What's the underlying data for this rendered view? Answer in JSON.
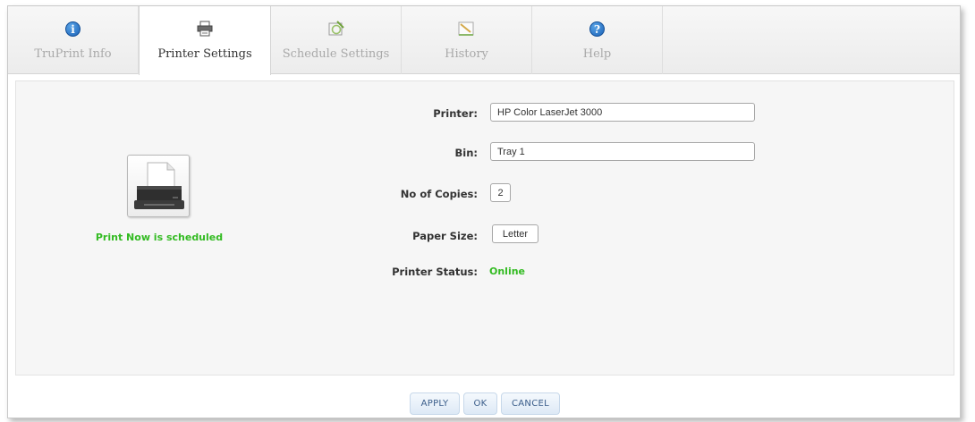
{
  "tabs": [
    {
      "label": "TruPrint Info",
      "icon": "info-icon"
    },
    {
      "label": "Printer Settings",
      "icon": "printer-icon",
      "active": true
    },
    {
      "label": "Schedule Settings",
      "icon": "schedule-icon"
    },
    {
      "label": "History",
      "icon": "history-icon"
    },
    {
      "label": "Help",
      "icon": "help-icon"
    }
  ],
  "left_panel": {
    "icon": "printer-large-icon",
    "status_message": "Print Now is scheduled"
  },
  "form": {
    "printer_label": "Printer:",
    "printer_value": "HP Color LaserJet 3000",
    "bin_label": "Bin:",
    "bin_value": "Tray 1",
    "copies_label": "No of Copies:",
    "copies_value": "2",
    "paper_label": "Paper Size:",
    "paper_value": "Letter",
    "status_label": "Printer Status:",
    "status_value": "Online"
  },
  "buttons": {
    "apply": "APPLY",
    "ok": "OK",
    "cancel": "CANCEL"
  },
  "colors": {
    "accent_green": "#33bb22",
    "icon_blue": "#1a62b8",
    "button_text": "#3a5d8a"
  }
}
